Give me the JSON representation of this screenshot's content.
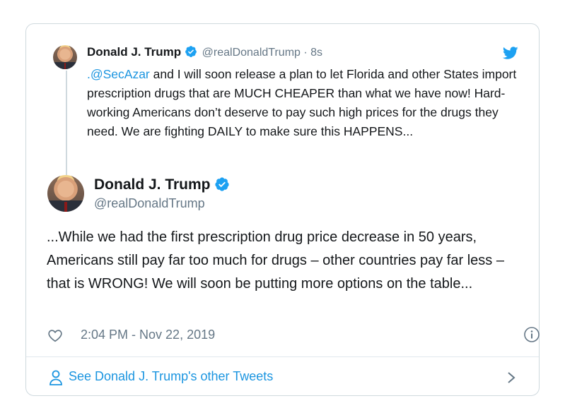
{
  "quoted_tweet": {
    "author_name": "Donald J. Trump",
    "handle_time": "@realDonaldTrump · 8s",
    "mention": ".@SecAzar",
    "text": " and I will soon release a plan to let Florida and other States import prescription drugs that are MUCH CHEAPER than what we have now! Hard-working Americans don’t deserve to pay such high prices for the drugs they need. We are fighting DAILY to make sure this HAPPENS..."
  },
  "main_tweet": {
    "author_name": "Donald J. Trump",
    "handle": "@realDonaldTrump",
    "text": "...While we had the first prescription drug price decrease in 50 years, Americans still pay far too much for drugs – other countries pay far less – that is WRONG! We will soon be putting more options on the table...",
    "timestamp": "2:04 PM - Nov 22, 2019"
  },
  "footer": {
    "link_label": "See Donald J. Trump's other Tweets"
  },
  "colors": {
    "accent": "#1b95e0",
    "verified": "#1da1f2",
    "muted": "#657786",
    "border": "#cfd9de"
  },
  "icons": [
    "twitter-bird-icon",
    "verified-badge-icon",
    "heart-icon",
    "info-icon",
    "person-icon",
    "chevron-right-icon"
  ]
}
